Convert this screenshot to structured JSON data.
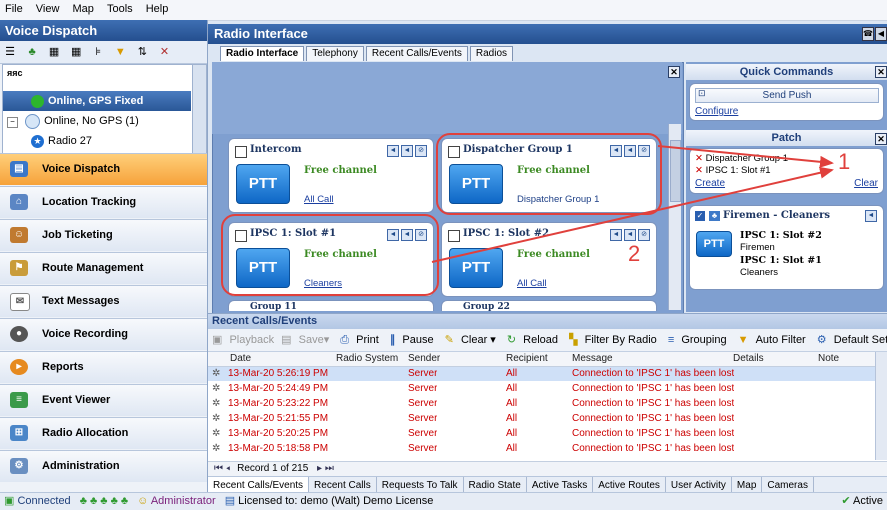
{
  "menu": [
    "File",
    "View",
    "Map",
    "Tools",
    "Help"
  ],
  "left_panel": {
    "title": "Voice Dispatch",
    "tree_filter": "яяс",
    "tree": [
      {
        "label": "Online, GPS Fixed",
        "color": "#2db52d"
      },
      {
        "label": "Online, No GPS (1)",
        "color": "#d6e6f7"
      },
      {
        "label": "Radio 27",
        "color": "#1f6fd1"
      }
    ],
    "nav": [
      "Voice Dispatch",
      "Location Tracking",
      "Job Ticketing",
      "Route Management",
      "Text Messages",
      "Voice Recording",
      "Reports",
      "Event Viewer",
      "Radio Allocation",
      "Administration"
    ]
  },
  "main": {
    "title": "Radio Interface",
    "tabs": [
      "Radio Interface",
      "Telephony",
      "Recent Calls/Events",
      "Radios"
    ],
    "ptt_label": "PTT",
    "cards": [
      {
        "title": "Intercom",
        "status": "",
        "channel": "All Call",
        "link": true
      },
      {
        "title": "Dispatcher Group 1",
        "status": "Free channel",
        "channel": "Dispatcher Group 1",
        "link": false
      },
      {
        "title": "IPSC 1: Slot #1",
        "status": "Free channel",
        "channel": "Cleaners",
        "link": true
      },
      {
        "title": "IPSC 1: Slot #2",
        "status": "Free channel",
        "channel": "All Call",
        "link": true
      },
      {
        "title": "Group 11",
        "status": "",
        "channel": "",
        "link": false
      },
      {
        "title": "Group 22",
        "status": "",
        "channel": "",
        "link": false
      }
    ],
    "intercom_status": "Free channel"
  },
  "quick_commands": {
    "title": "Quick Commands",
    "send_push": "Send Push",
    "configure": "Configure",
    "patch_title": "Patch",
    "patch_items": [
      "Dispatcher Group 1",
      "IPSC 1: Slot #1"
    ],
    "create": "Create",
    "clear": "Clear",
    "patch_group": {
      "name": "Firemen - Cleaners",
      "lines": [
        {
          "slot": "IPSC 1: Slot #2",
          "group": "Firemen"
        },
        {
          "slot": "IPSC 1: Slot #1",
          "group": "Cleaners"
        }
      ]
    }
  },
  "recent_calls": {
    "title": "Recent Calls/Events",
    "toolbar": [
      "Playback",
      "Save",
      "Print",
      "Pause",
      "Clear",
      "Reload",
      "Filter By Radio",
      "Grouping",
      "Auto Filter",
      "Default Settings"
    ],
    "columns": [
      "Date",
      "Radio System",
      "Sender",
      "Recipient",
      "Message",
      "Details",
      "Note"
    ],
    "rows": [
      [
        "13-Mar-20 5:26:19 PM",
        "",
        "Server",
        "All",
        "Connection to 'IPSC 1' has been lost",
        "",
        ""
      ],
      [
        "13-Mar-20 5:24:49 PM",
        "",
        "Server",
        "All",
        "Connection to 'IPSC 1' has been lost",
        "",
        ""
      ],
      [
        "13-Mar-20 5:23:22 PM",
        "",
        "Server",
        "All",
        "Connection to 'IPSC 1' has been lost",
        "",
        ""
      ],
      [
        "13-Mar-20 5:21:55 PM",
        "",
        "Server",
        "All",
        "Connection to 'IPSC 1' has been lost",
        "",
        ""
      ],
      [
        "13-Mar-20 5:20:25 PM",
        "",
        "Server",
        "All",
        "Connection to 'IPSC 1' has been lost",
        "",
        ""
      ],
      [
        "13-Mar-20 5:18:58 PM",
        "",
        "Server",
        "All",
        "Connection to 'IPSC 1' has been lost",
        "",
        ""
      ]
    ],
    "pager": "Record 1 of 215",
    "bottom_tabs": [
      "Recent Calls/Events",
      "Recent Calls",
      "Requests To Talk",
      "Radio State",
      "Active Tasks",
      "Active Routes",
      "User Activity",
      "Map",
      "Cameras"
    ]
  },
  "status_bar": {
    "connected": "Connected",
    "user": "Administrator",
    "license": "Licensed to: demo (Walt) Demo License",
    "active": "Active"
  },
  "annotations": {
    "one": "1",
    "two": "2",
    "color": "#e0403c"
  }
}
